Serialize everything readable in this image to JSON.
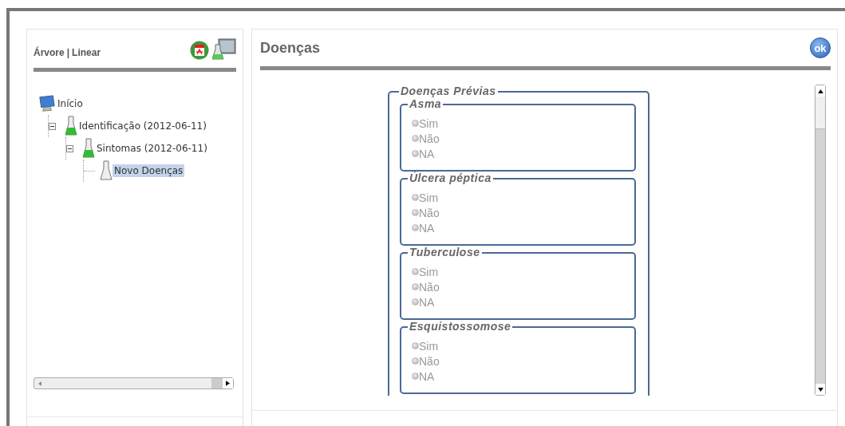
{
  "tree_panel": {
    "view_links": [
      "Árvore",
      "Linear"
    ],
    "separator": "|",
    "tree": [
      {
        "label": "Início",
        "kind": "computer",
        "selected": false,
        "children": [
          {
            "label": "Identificação (2012-06-11)",
            "kind": "flask-green",
            "selected": false,
            "expanded": true,
            "children": [
              {
                "label": "Sintomas (2012-06-11)",
                "kind": "flask-green",
                "selected": false,
                "expanded": true,
                "children": [
                  {
                    "label": "Novo Doenças",
                    "kind": "flask-empty",
                    "selected": true
                  }
                ]
              }
            ]
          }
        ]
      }
    ]
  },
  "form_panel": {
    "title": "Doenças",
    "ok_button": "ok",
    "fieldset": {
      "legend": "Doenças Prévias",
      "groups": [
        {
          "legend": "Asma",
          "options": [
            {
              "label": "Sim",
              "checked": false
            },
            {
              "label": "Não",
              "checked": false
            },
            {
              "label": "NA",
              "checked": false
            }
          ]
        },
        {
          "legend": "Úlcera péptica",
          "options": [
            {
              "label": "Sim",
              "checked": false
            },
            {
              "label": "Não",
              "checked": false
            },
            {
              "label": "NA",
              "checked": false
            }
          ]
        },
        {
          "legend": "Tuberculose",
          "options": [
            {
              "label": "Sim",
              "checked": false
            },
            {
              "label": "Não",
              "checked": false
            },
            {
              "label": "NA",
              "checked": false
            }
          ]
        },
        {
          "legend": "Esquistossomose",
          "options": [
            {
              "label": "Sim",
              "checked": false
            },
            {
              "label": "Não",
              "checked": false
            },
            {
              "label": "NA",
              "checked": false
            }
          ]
        }
      ]
    }
  }
}
